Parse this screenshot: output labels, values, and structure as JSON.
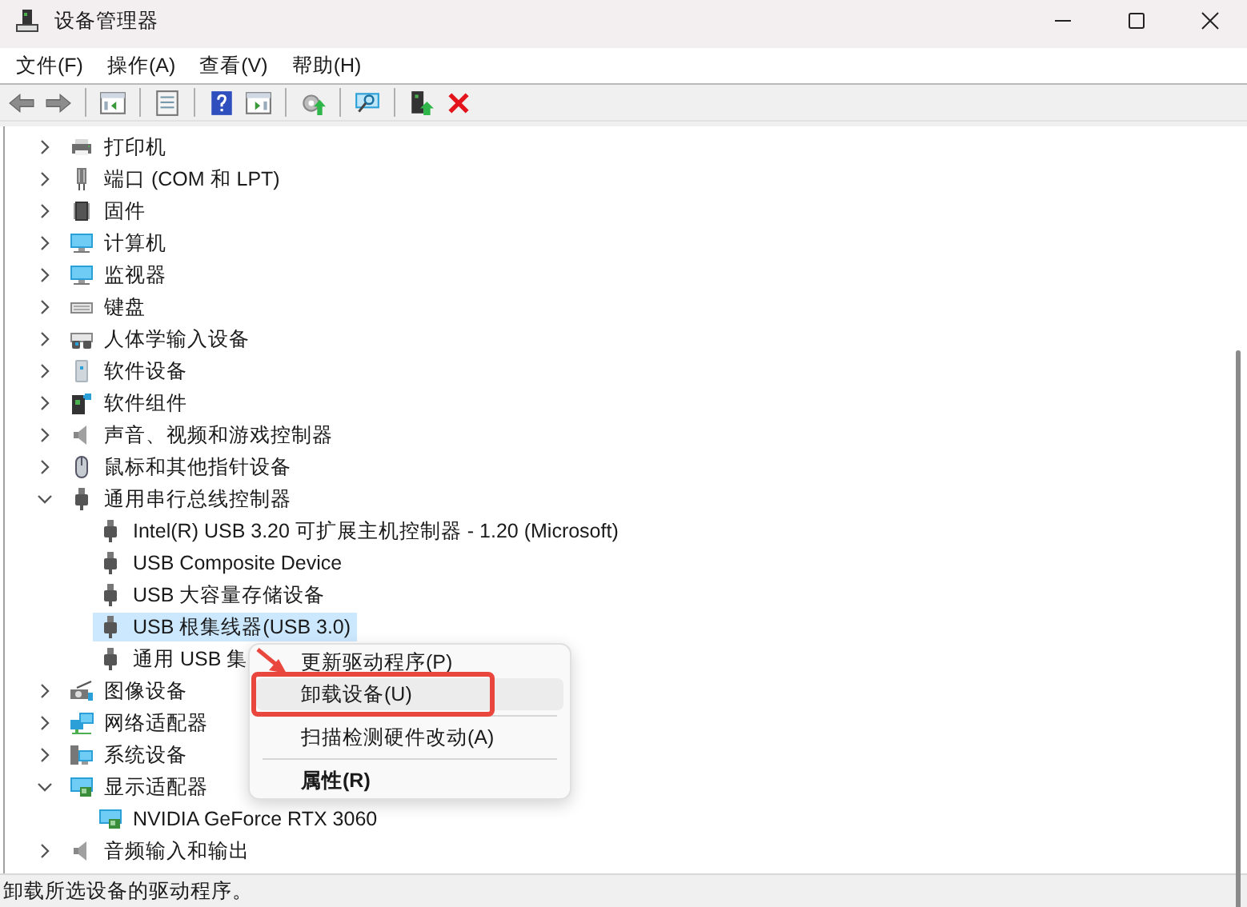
{
  "window": {
    "title": "设备管理器"
  },
  "menu_bar": [
    "文件(F)",
    "操作(A)",
    "查看(V)",
    "帮助(H)"
  ],
  "tree": [
    {
      "label": "打印机",
      "kind": "printer",
      "expanded": false,
      "selected": false
    },
    {
      "label": "端口 (COM 和 LPT)",
      "kind": "port",
      "expanded": false,
      "selected": false
    },
    {
      "label": "固件",
      "kind": "chip",
      "expanded": false,
      "selected": false
    },
    {
      "label": "计算机",
      "kind": "monitor",
      "expanded": false,
      "selected": false
    },
    {
      "label": "监视器",
      "kind": "monitor",
      "expanded": false,
      "selected": false
    },
    {
      "label": "键盘",
      "kind": "keyboard",
      "expanded": false,
      "selected": false
    },
    {
      "label": "人体学输入设备",
      "kind": "hid",
      "expanded": false,
      "selected": false
    },
    {
      "label": "软件设备",
      "kind": "tower",
      "expanded": false,
      "selected": false
    },
    {
      "label": "软件组件",
      "kind": "component",
      "expanded": false,
      "selected": false
    },
    {
      "label": "声音、视频和游戏控制器",
      "kind": "speaker",
      "expanded": false,
      "selected": false
    },
    {
      "label": "鼠标和其他指针设备",
      "kind": "mouse",
      "expanded": false,
      "selected": false
    },
    {
      "label": "通用串行总线控制器",
      "kind": "usb",
      "expanded": true,
      "selected": false,
      "children": [
        {
          "label": "Intel(R) USB 3.20 可扩展主机控制器 - 1.20 (Microsoft)",
          "kind": "usb",
          "selected": false
        },
        {
          "label": "USB Composite Device",
          "kind": "usb",
          "selected": false
        },
        {
          "label": "USB 大容量存储设备",
          "kind": "usb",
          "selected": false
        },
        {
          "label": "USB 根集线器(USB 3.0)",
          "kind": "usb",
          "selected": true
        },
        {
          "label": "通用 USB 集",
          "kind": "usb",
          "selected": false
        }
      ]
    },
    {
      "label": "图像设备",
      "kind": "camera",
      "expanded": false,
      "selected": false
    },
    {
      "label": "网络适配器",
      "kind": "network",
      "expanded": false,
      "selected": false
    },
    {
      "label": "系统设备",
      "kind": "system",
      "expanded": false,
      "selected": false
    },
    {
      "label": "显示适配器",
      "kind": "gpu",
      "expanded": true,
      "selected": false,
      "children": [
        {
          "label": "NVIDIA GeForce RTX 3060",
          "kind": "gpu",
          "selected": false
        }
      ]
    },
    {
      "label": "音频输入和输出",
      "kind": "speaker",
      "expanded": false,
      "selected": false
    }
  ],
  "context_menu": [
    {
      "kind": "item",
      "label": "更新驱动程序(P)",
      "selected": false,
      "highlighted": false
    },
    {
      "kind": "item",
      "label": "卸载设备(U)",
      "selected": true,
      "highlighted": true
    },
    {
      "kind": "separator"
    },
    {
      "kind": "item",
      "label": "扫描检测硬件改动(A)",
      "selected": false,
      "highlighted": false
    },
    {
      "kind": "separator"
    },
    {
      "kind": "default",
      "label": "属性(R)",
      "selected": false,
      "highlighted": false
    }
  ],
  "status_bar": "卸载所选设备的驱动程序。"
}
